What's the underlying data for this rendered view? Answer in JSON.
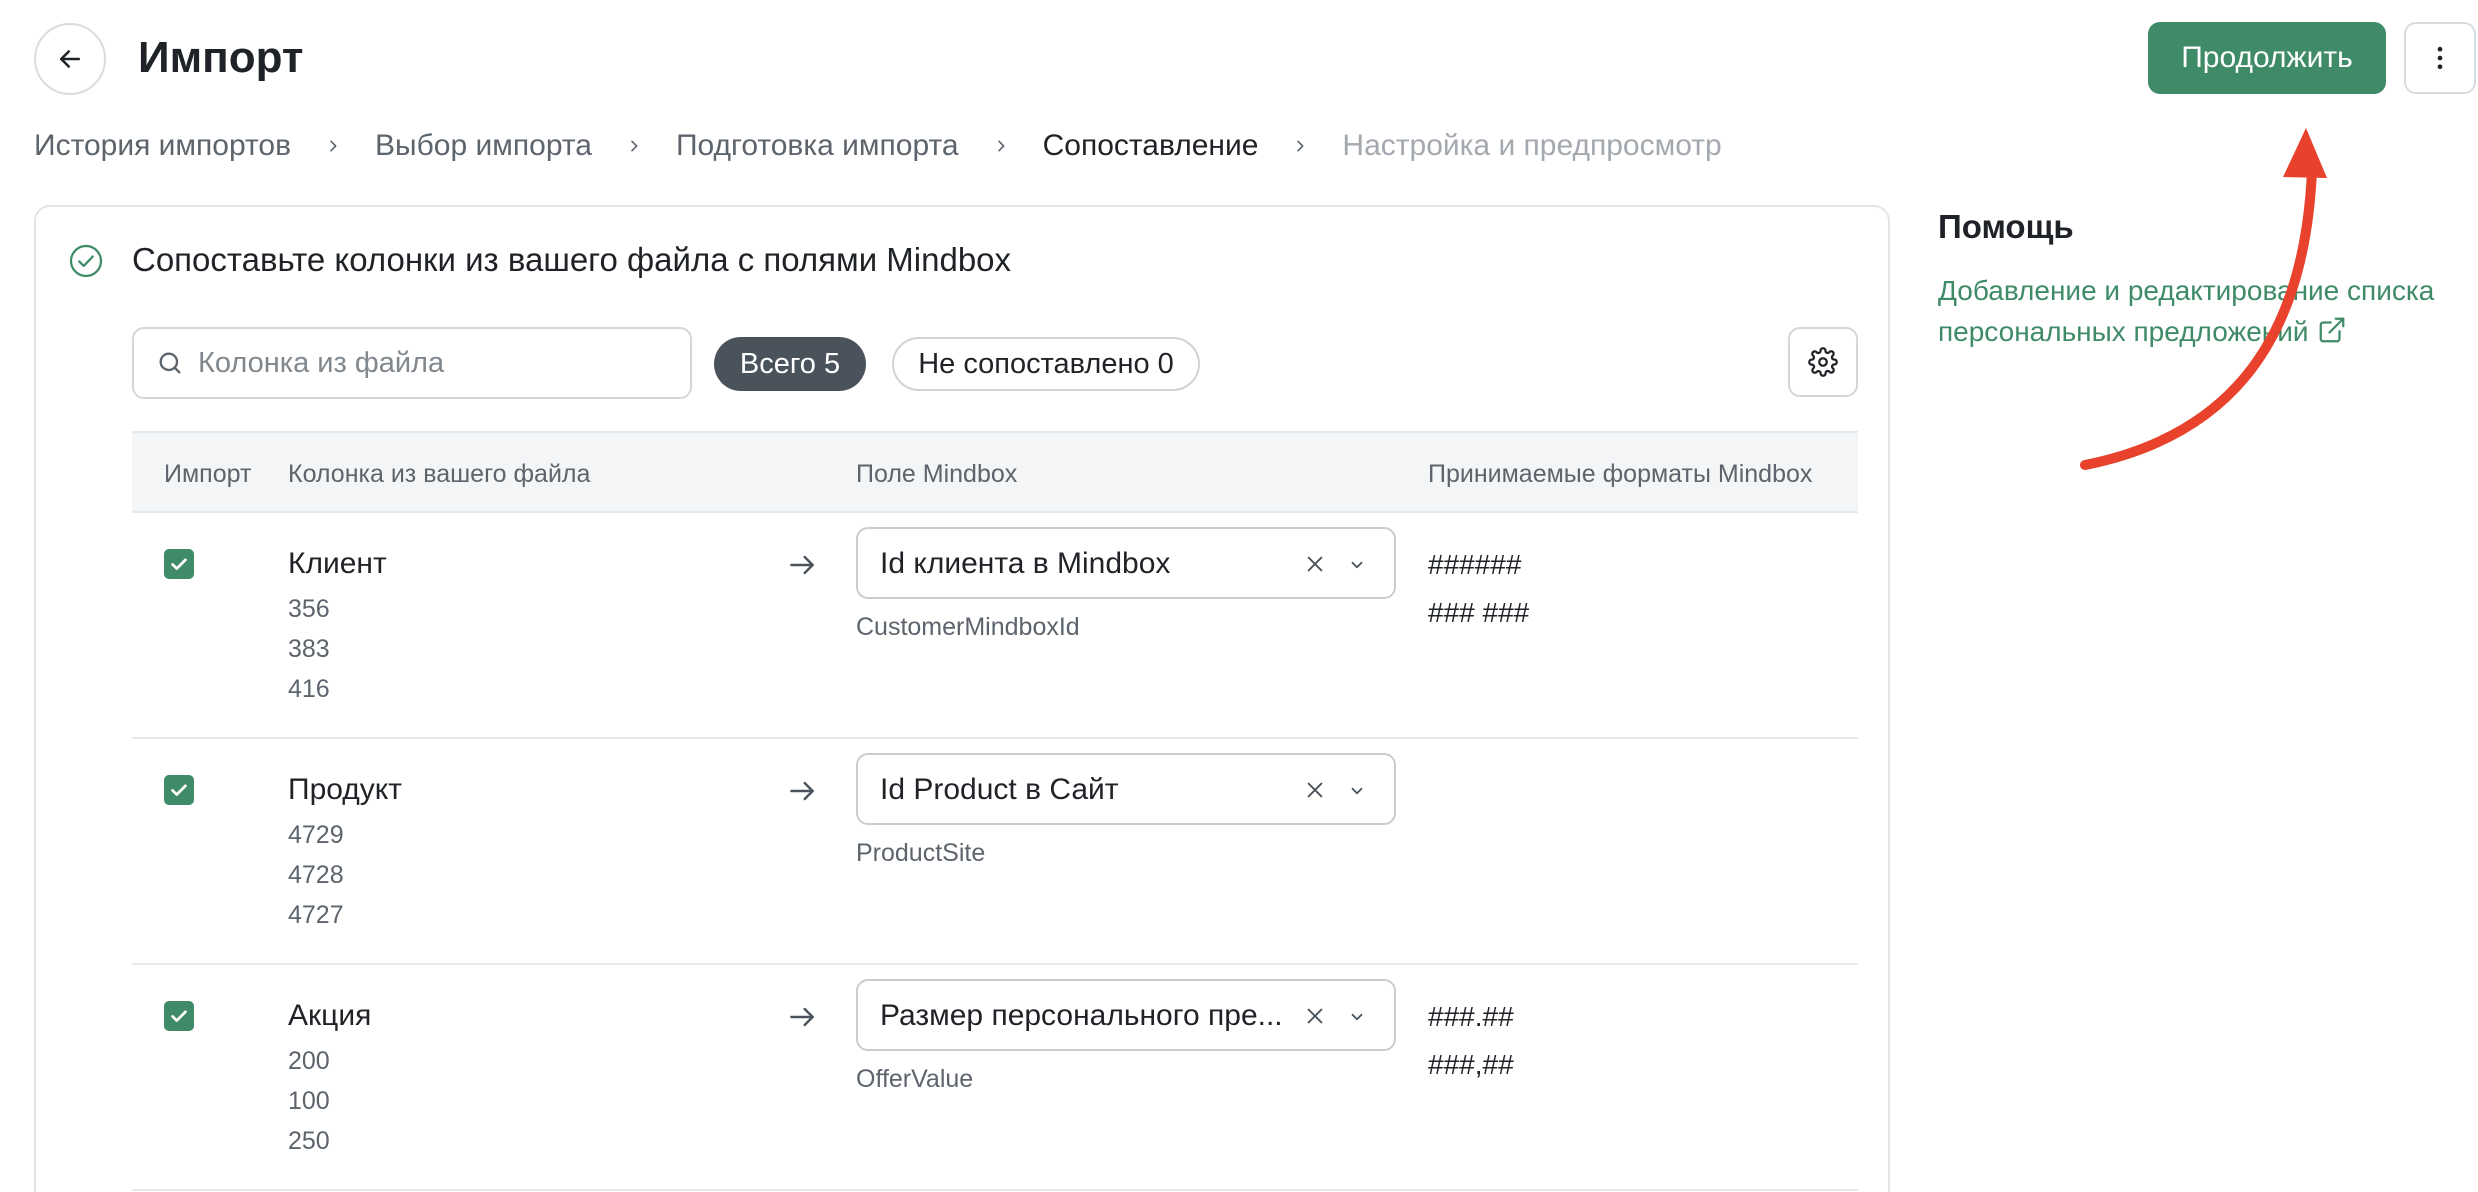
{
  "header": {
    "title": "Импорт",
    "continue_label": "Продолжить"
  },
  "breadcrumbs": [
    {
      "label": "История импортов",
      "state": "link"
    },
    {
      "label": "Выбор импорта",
      "state": "link"
    },
    {
      "label": "Подготовка импорта",
      "state": "link"
    },
    {
      "label": "Сопоставление",
      "state": "active"
    },
    {
      "label": "Настройка и предпросмотр",
      "state": "disabled"
    }
  ],
  "card": {
    "title": "Сопоставьте колонки из вашего файла с полями Mindbox",
    "search_placeholder": "Колонка из файла",
    "chip_all": "Всего 5",
    "chip_unmatched": "Не сопоставлено 0"
  },
  "table": {
    "headers": {
      "import": "Импорт",
      "file_column": "Колонка из вашего файла",
      "mindbox_field": "Поле Mindbox",
      "formats": "Принимаемые форматы Mindbox"
    },
    "rows": [
      {
        "checked": true,
        "column": "Клиент",
        "samples": [
          "356",
          "383",
          "416"
        ],
        "field": "Id клиента в Mindbox",
        "field_key": "CustomerMindboxId",
        "formats": [
          "######",
          "### ###"
        ]
      },
      {
        "checked": true,
        "column": "Продукт",
        "samples": [
          "4729",
          "4728",
          "4727"
        ],
        "field": "Id Product в Сайт",
        "field_key": "ProductSite",
        "formats": []
      },
      {
        "checked": true,
        "column": "Акция",
        "samples": [
          "200",
          "100",
          "250"
        ],
        "field": "Размер персонального пре...",
        "field_key": "OfferValue",
        "formats": [
          "###.##",
          "###,##"
        ]
      }
    ]
  },
  "help": {
    "title": "Помощь",
    "link_line1": "Добавление и редактирование списка",
    "link_line2": "персональных предложений"
  },
  "colors": {
    "accent": "#3f8b68",
    "annotation_arrow": "#e8412c",
    "chip_active_bg": "#4a535c"
  }
}
